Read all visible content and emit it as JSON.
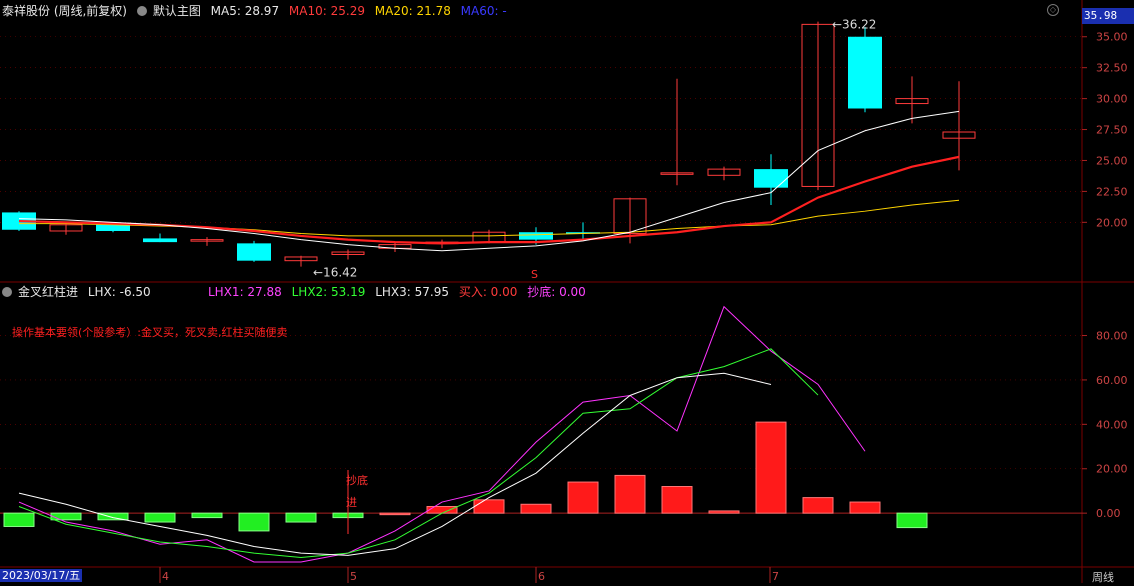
{
  "header": {
    "stock_name": "泰祥股份 (周线,前复权)",
    "chart_name": "默认主图",
    "ma5": "MA5: 28.97",
    "ma10": "MA10: 25.29",
    "ma20": "MA20: 21.78",
    "ma60": "MA60: -"
  },
  "indicator": {
    "name": "金叉红柱进",
    "lhx": "LHX: -6.50",
    "lhx1": "LHX1: 27.88",
    "lhx2": "LHX2: 53.19",
    "lhx3": "LHX3: 57.95",
    "buy": "买入: 0.00",
    "bottom": "抄底: 0.00",
    "note": "操作基本要领(个股参考）:金叉买，死叉卖,红柱买随便卖"
  },
  "price_axis": {
    "current": "35.98",
    "ticks": [
      "35.00",
      "32.50",
      "30.00",
      "27.50",
      "25.00",
      "22.50",
      "20.00"
    ]
  },
  "ind_axis": {
    "ticks": [
      "80.00",
      "60.00",
      "40.00",
      "20.00",
      "0.00"
    ]
  },
  "time_axis": {
    "start_date": "2023/03/17/五",
    "months": [
      "4",
      "5",
      "6",
      "7"
    ],
    "period": "周线"
  },
  "annotations": {
    "high": "36.22",
    "low": "16.42",
    "signal_s": "S",
    "chaodi": "抄底",
    "jin": "进"
  },
  "colors": {
    "up": "#ff3b3b",
    "down": "#00ffff",
    "ma5": "#ffffff",
    "ma10": "#ff2020",
    "ma20": "#ffd500",
    "grid": "#7a0000"
  },
  "chart_data": [
    {
      "type": "candlestick",
      "title": "泰祥股份 (周线,前复权)",
      "ylim": [
        15.5,
        37
      ],
      "candles": [
        {
          "o": 20.8,
          "h": 20.9,
          "l": 19.3,
          "c": 19.4
        },
        {
          "o": 19.3,
          "h": 20.0,
          "l": 19.0,
          "c": 19.8
        },
        {
          "o": 19.9,
          "h": 20.0,
          "l": 19.2,
          "c": 19.3
        },
        {
          "o": 18.7,
          "h": 19.1,
          "l": 18.4,
          "c": 18.4
        },
        {
          "o": 18.5,
          "h": 18.8,
          "l": 18.1,
          "c": 18.6
        },
        {
          "o": 18.3,
          "h": 18.5,
          "l": 16.8,
          "c": 16.9
        },
        {
          "o": 16.9,
          "h": 17.3,
          "l": 16.42,
          "c": 17.2
        },
        {
          "o": 17.4,
          "h": 17.8,
          "l": 17.0,
          "c": 17.6
        },
        {
          "o": 17.9,
          "h": 18.4,
          "l": 17.6,
          "c": 18.2
        },
        {
          "o": 18.3,
          "h": 18.6,
          "l": 17.9,
          "c": 18.4
        },
        {
          "o": 18.4,
          "h": 19.4,
          "l": 18.3,
          "c": 19.2
        },
        {
          "o": 19.2,
          "h": 19.6,
          "l": 18.2,
          "c": 18.6
        },
        {
          "o": 19.2,
          "h": 20.0,
          "l": 18.6,
          "c": 19.1
        },
        {
          "o": 19.1,
          "h": 22.0,
          "l": 18.3,
          "c": 21.9
        },
        {
          "o": 24.0,
          "h": 31.6,
          "l": 23.0,
          "c": 24.0
        },
        {
          "o": 23.8,
          "h": 24.5,
          "l": 23.4,
          "c": 24.3
        },
        {
          "o": 24.3,
          "h": 25.5,
          "l": 21.4,
          "c": 22.8
        },
        {
          "o": 22.9,
          "h": 36.22,
          "l": 22.6,
          "c": 36.0
        },
        {
          "o": 35.0,
          "h": 35.8,
          "l": 28.9,
          "c": 29.2
        },
        {
          "o": 29.6,
          "h": 31.8,
          "l": 28.0,
          "c": 30.0
        },
        {
          "o": 26.8,
          "h": 31.4,
          "l": 24.2,
          "c": 27.3
        }
      ],
      "ma5": [
        20.3,
        20.2,
        20.0,
        19.8,
        19.5,
        19.1,
        18.6,
        18.2,
        17.9,
        17.7,
        17.9,
        18.1,
        18.5,
        19.2,
        20.4,
        21.6,
        22.4,
        25.8,
        27.4,
        28.4,
        28.97
      ],
      "ma10": [
        20.1,
        20.0,
        19.9,
        19.8,
        19.6,
        19.3,
        18.9,
        18.6,
        18.4,
        18.3,
        18.4,
        18.4,
        18.6,
        18.9,
        19.2,
        19.7,
        20.0,
        22.0,
        23.3,
        24.5,
        25.29
      ],
      "ma20": [
        19.9,
        19.9,
        19.8,
        19.7,
        19.6,
        19.4,
        19.1,
        18.9,
        18.9,
        18.9,
        18.9,
        19.0,
        19.1,
        19.2,
        19.5,
        19.7,
        19.8,
        20.5,
        20.9,
        21.4,
        21.78
      ]
    },
    {
      "type": "bar",
      "title": "金叉红柱进",
      "ylim": [
        -22,
        96
      ],
      "bars": [
        -6,
        -3,
        -3,
        -4,
        -2,
        -8,
        -4,
        -2,
        0,
        3,
        6,
        4,
        14,
        17,
        12,
        1,
        41,
        7,
        5,
        -6.5
      ],
      "lhx1": [
        5,
        -4,
        -8,
        -14,
        -12,
        -22,
        -22,
        -18,
        -8,
        5,
        10,
        32,
        50,
        53,
        37,
        93,
        73,
        58,
        27.88
      ],
      "lhx2": [
        3,
        -5,
        -9,
        -13,
        -15,
        -18,
        -20,
        -18,
        -12,
        0,
        9,
        25,
        45,
        47,
        61,
        66,
        74,
        53.19
      ],
      "lhx3": [
        9,
        4,
        -2,
        -6,
        -10,
        -15,
        -18,
        -19,
        -16,
        -6,
        7,
        18,
        36,
        53,
        61,
        63,
        57.95
      ]
    }
  ]
}
